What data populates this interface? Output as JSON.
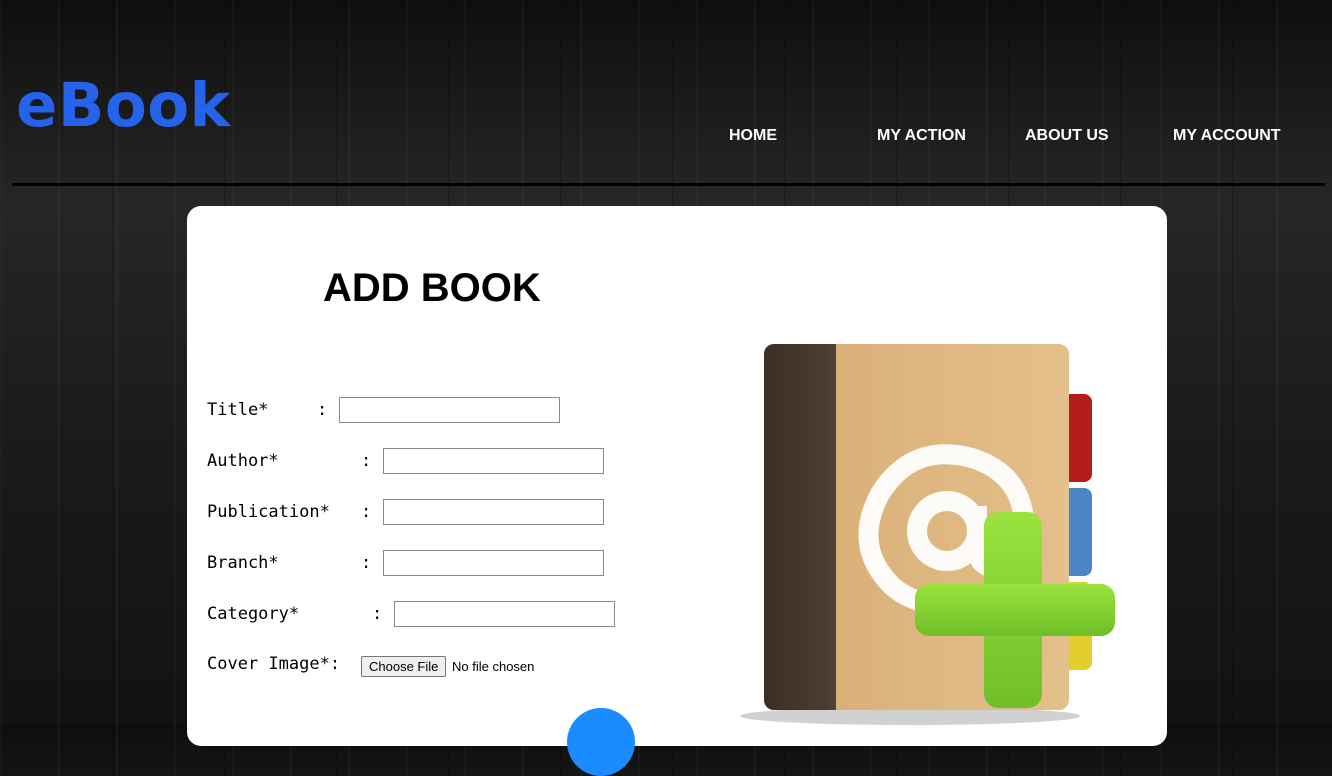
{
  "brand": {
    "name": "eBook",
    "color": "#2563eb"
  },
  "nav": {
    "items": [
      {
        "label": "HOME"
      },
      {
        "label": "MY ACTION"
      },
      {
        "label": "ABOUT US"
      },
      {
        "label": "MY ACCOUNT"
      }
    ]
  },
  "page": {
    "title": "ADD BOOK"
  },
  "form": {
    "title": {
      "label": "Title*",
      "value": ""
    },
    "author": {
      "label": "Author*",
      "value": ""
    },
    "publication": {
      "label": "Publication*",
      "value": ""
    },
    "branch": {
      "label": "Branch*",
      "value": ""
    },
    "category": {
      "label": "Category*",
      "value": ""
    },
    "cover_image": {
      "label": "Cover Image*:",
      "button_label": "Choose File",
      "status": "No file chosen"
    },
    "separator": ":"
  },
  "icons": {
    "illustration": "address-book-add-icon",
    "submit": "submit-button"
  },
  "colors": {
    "submit": "#1a8cff",
    "plus": "#7ccf2a"
  }
}
